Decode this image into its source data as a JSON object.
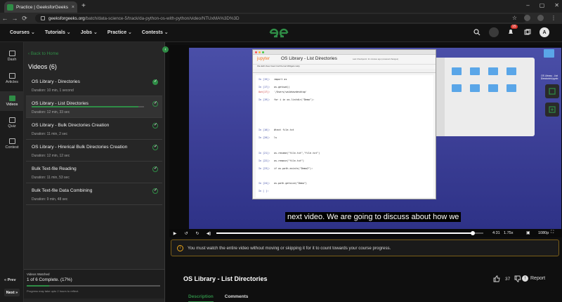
{
  "browser": {
    "tab_title": "Practice | GeeksforGeeks | A",
    "tab_close": "×",
    "new_tab": "+",
    "url_host": "geeksforgeeks.org",
    "url_path": "/batch/data-science-5/track/da-python-os-with-python/video/NTUxMA%3D%3D",
    "back": "←",
    "forward": "→",
    "reload": "C"
  },
  "header": {
    "nav": [
      "Courses ⌄",
      "Tutorials ⌄",
      "Jobs ⌄",
      "Practice ⌄",
      "Contests ⌄"
    ],
    "logo_text": "GfG",
    "notif_count": "15",
    "avatar": "A"
  },
  "rail": {
    "items": [
      "Dash",
      "Articles",
      "Videos",
      "Quiz",
      "Contest"
    ],
    "prev": "« Prev",
    "next": "Next »"
  },
  "sidebar": {
    "back": "‹ Back to Home",
    "heading": "Videos (6)",
    "videos": [
      {
        "title": "OS Library - Directories",
        "duration": "Duration: 10 min, 1 second",
        "done": true
      },
      {
        "title": "OS Library - List Directories",
        "duration": "Duration: 12 min, 33 sec",
        "done": false,
        "progress": 0.95
      },
      {
        "title": "OS Library - Bulk Directories Creation",
        "duration": "Duration: 11 min, 2 sec",
        "done": false
      },
      {
        "title": "OS Library - Hirerical Bulk Directories Creation",
        "duration": "Duration: 12 min, 12 sec",
        "done": false
      },
      {
        "title": "Bulk Text-file Reading",
        "duration": "Duration: 11 min, 53 sec",
        "done": false
      },
      {
        "title": "Bulk Text-file Data Combining",
        "duration": "Duration: 9 min, 48 sec",
        "done": false
      }
    ],
    "watched_label": "Videos Watched",
    "watched_count": "1 of 6 Complete. (17%)",
    "watched_fraction": 0.17,
    "watched_note": "Progress may take upto 2 hours to reflect."
  },
  "video": {
    "jupyter_logo": "jupyter",
    "notebook_title": "OS Library - List Directories",
    "notebook_status": "Last Checkpoint: 11 minutes ago (unsaved changes)",
    "jupyter_menu": "File  Edit  View  Insert  Cell  Kernel  Widgets  Help",
    "cells": [
      {
        "prompt": "In [15]:",
        "code": "import os"
      },
      {
        "prompt": "In [17]:",
        "code": "os.getcwd()"
      },
      {
        "prompt": "Out[17]:",
        "code": "'/Users/vaibhavdesktop'"
      },
      {
        "prompt": "In [19]:",
        "code": "for i in os.listdir(\"Demo\"):"
      },
      {
        "prompt": "In [10]:",
        "code": "#text file.txt"
      },
      {
        "prompt": "In [20]:",
        "code": "ls"
      },
      {
        "prompt": "In [21]:",
        "code": "os.rename(\"file.txt\",\"file.txt\")"
      },
      {
        "prompt": "In [22]:",
        "code": "os.remove(\"file.txt\")"
      },
      {
        "prompt": "In [23]:",
        "code": "if os.path.exists(\"Demo2\"):"
      },
      {
        "prompt": "In [24]:",
        "code": "os.path.getsize(\"Demo\")"
      },
      {
        "prompt": "In [ ]:",
        "code": ""
      }
    ],
    "desktop_label": "OS Library - List Directories.ipynb",
    "caption": "next video. We are going to discuss about how we",
    "time": "4:31",
    "speed": "1.75x",
    "quality": "1080p",
    "seek_fraction": 0.96
  },
  "notice": {
    "text": "You must watch the entire video without moving or skipping it for it to count towards your course progress."
  },
  "content": {
    "title": "OS Library - List Directories",
    "likes": "37",
    "report": "Report",
    "tabs": [
      "Description",
      "Comments"
    ]
  },
  "colors": {
    "accent": "#2f8d46",
    "warning": "#e5a31b"
  }
}
